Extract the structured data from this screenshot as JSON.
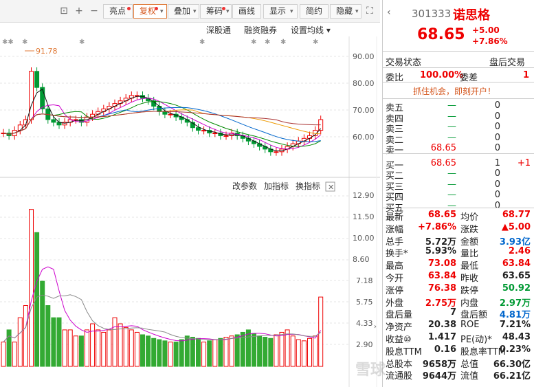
{
  "toolbar": {
    "buttons": [
      "亮点",
      "复权",
      "叠加",
      "筹码",
      "画线",
      "显示",
      "简约",
      "隐藏"
    ],
    "active": "复权"
  },
  "subbar": {
    "items": [
      "深股通",
      "融资融券",
      "设置均线"
    ]
  },
  "kline": {
    "max_label": "91.78",
    "price_axis": [
      "90.00",
      "80.00",
      "70.00",
      "60.00"
    ],
    "indicator_buttons": [
      "改参数",
      "加指标",
      "换指标"
    ],
    "vol_axis": [
      "12.90",
      "11.50",
      "10.00",
      "8.60",
      "7.18",
      "5.75",
      "4.33",
      "2.90"
    ]
  },
  "quote": {
    "code": "301333",
    "name": "诺思格",
    "price": "68.65",
    "change": "+5.00",
    "change_pct": "+7.86%",
    "status_label": "交易状态",
    "status_value": "盘后交易",
    "weibi_label": "委比",
    "weibi_value": "100.00%",
    "weicha_label": "委差",
    "weicha_value": "1",
    "promo": "抓住机会，即刻开户！"
  },
  "order_book": {
    "sell": [
      {
        "label": "卖五",
        "price": "—",
        "vol": "0",
        "chg": ""
      },
      {
        "label": "卖四",
        "price": "—",
        "vol": "0",
        "chg": ""
      },
      {
        "label": "卖三",
        "price": "—",
        "vol": "0",
        "chg": ""
      },
      {
        "label": "卖二",
        "price": "—",
        "vol": "0",
        "chg": ""
      },
      {
        "label": "卖一",
        "price": "68.65",
        "vol": "0",
        "chg": ""
      }
    ],
    "buy": [
      {
        "label": "买一",
        "price": "68.65",
        "vol": "1",
        "chg": "+1"
      },
      {
        "label": "买二",
        "price": "—",
        "vol": "0",
        "chg": ""
      },
      {
        "label": "买三",
        "price": "—",
        "vol": "0",
        "chg": ""
      },
      {
        "label": "买四",
        "price": "—",
        "vol": "0",
        "chg": ""
      },
      {
        "label": "买五",
        "price": "—",
        "vol": "0",
        "chg": ""
      }
    ]
  },
  "stats": [
    {
      "l1": "最新",
      "v1": "68.65",
      "c1": "red",
      "l2": "均价",
      "v2": "68.77",
      "c2": "red"
    },
    {
      "l1": "涨幅",
      "v1": "+7.86%",
      "c1": "red",
      "l2": "涨跌",
      "v2": "▲5.00",
      "c2": "red"
    },
    {
      "l1": "总手",
      "v1": "5.72万",
      "c1": "",
      "l2": "金额",
      "v2": "3.93亿",
      "c2": "blue"
    },
    {
      "l1": "换手*",
      "v1": "5.93%",
      "c1": "",
      "l2": "量比",
      "v2": "2.46",
      "c2": "red"
    },
    {
      "l1": "最高",
      "v1": "73.08",
      "c1": "red",
      "l2": "最低",
      "v2": "63.84",
      "c2": "red"
    },
    {
      "l1": "今开",
      "v1": "63.84",
      "c1": "red",
      "l2": "昨收",
      "v2": "63.65",
      "c2": ""
    },
    {
      "l1": "涨停",
      "v1": "76.38",
      "c1": "red",
      "l2": "跌停",
      "v2": "50.92",
      "c2": "green"
    },
    {
      "l1": "外盘",
      "v1": "2.75万",
      "c1": "red",
      "l2": "内盘",
      "v2": "2.97万",
      "c2": "green"
    },
    {
      "l1": "盘后量",
      "v1": "7",
      "c1": "",
      "l2": "盘后额",
      "v2": "4.81万",
      "c2": "blue"
    },
    {
      "l1": "净资产",
      "v1": "20.38",
      "c1": "",
      "l2": "ROE",
      "v2": "7.21%",
      "c2": ""
    },
    {
      "l1": "收益⑩",
      "v1": "1.417",
      "c1": "",
      "l2": "PE(动)*",
      "v2": "48.43",
      "c2": ""
    },
    {
      "l1": "股息TTM",
      "v1": "0.16",
      "c1": "",
      "l2": "股息率TTM",
      "v2": "0.23%",
      "c2": ""
    },
    {
      "l1": "总股本",
      "v1": "9658万",
      "c1": "",
      "l2": "总值",
      "v2": "66.30亿",
      "c2": ""
    },
    {
      "l1": "流通股",
      "v1": "9644万",
      "c1": "",
      "l2": "流值",
      "v2": "66.21亿",
      "c2": ""
    }
  ],
  "watermark": "雪球",
  "colors": {
    "up": "#e00",
    "down": "#093",
    "accent": "#e07b39"
  }
}
